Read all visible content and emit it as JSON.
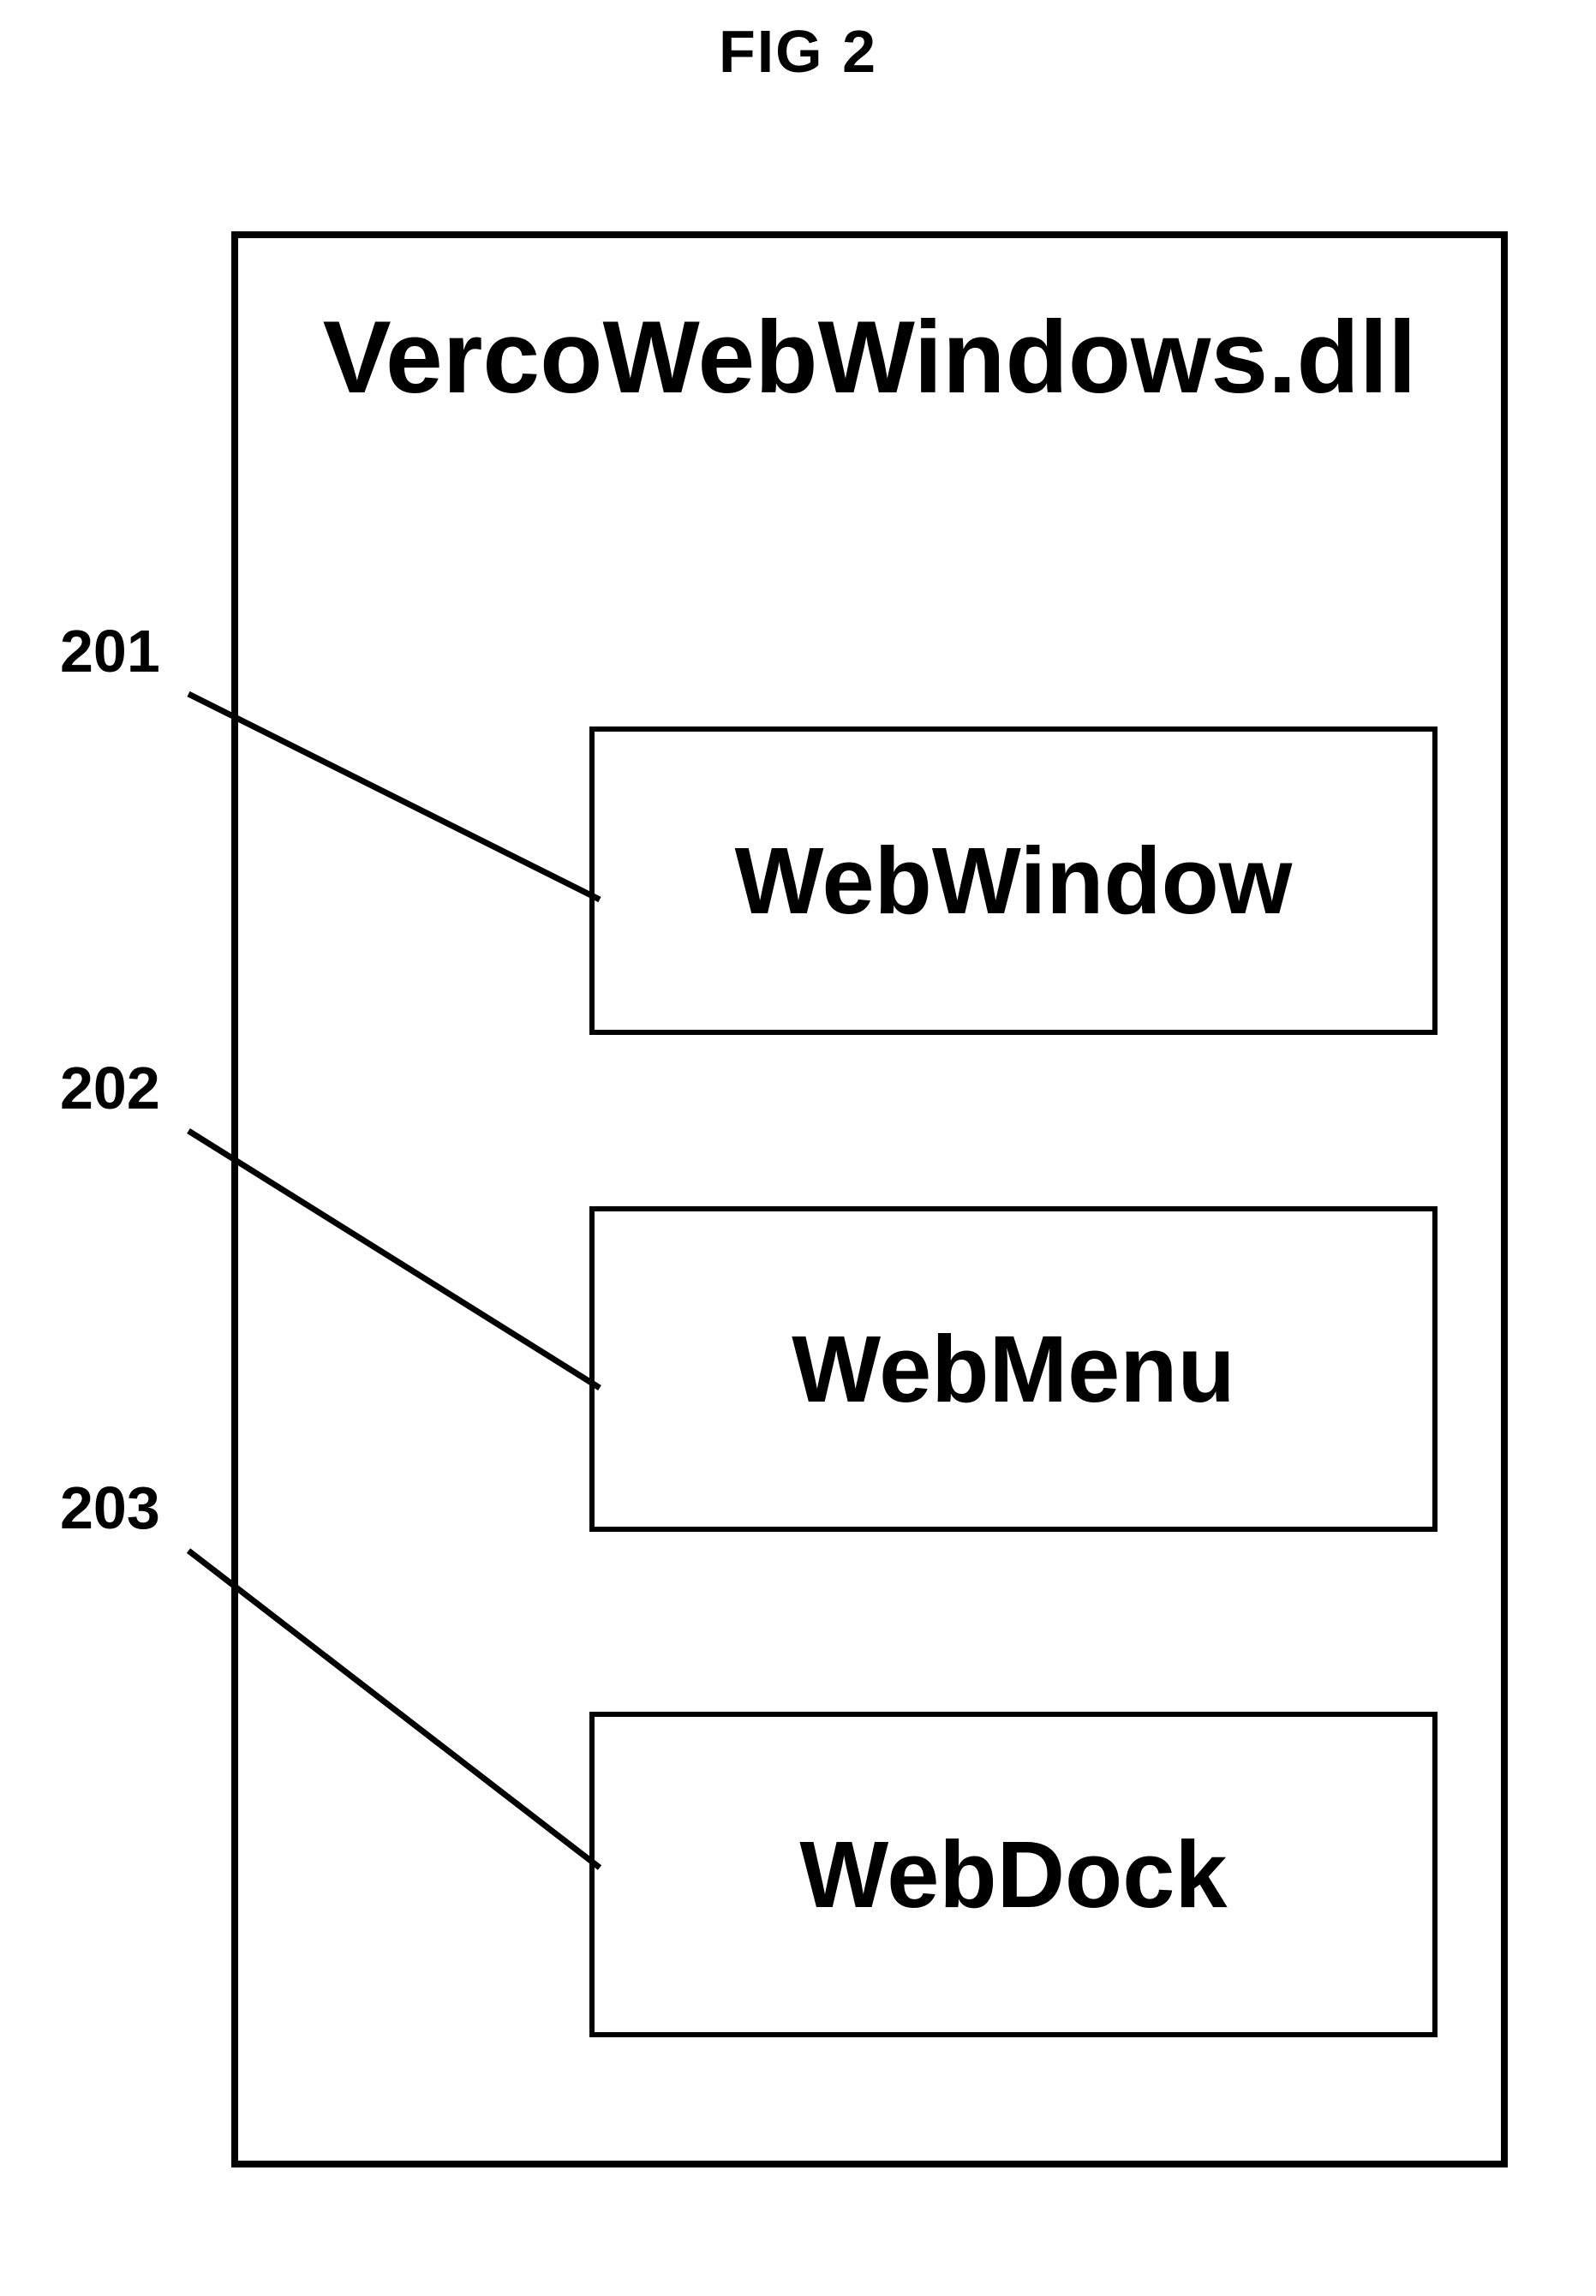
{
  "figure_label": "FIG 2",
  "container_title": "VercoWebWindows.dll",
  "components": [
    {
      "ref": "201",
      "name": "WebWindow"
    },
    {
      "ref": "202",
      "name": "WebMenu"
    },
    {
      "ref": "203",
      "name": "WebDock"
    }
  ]
}
